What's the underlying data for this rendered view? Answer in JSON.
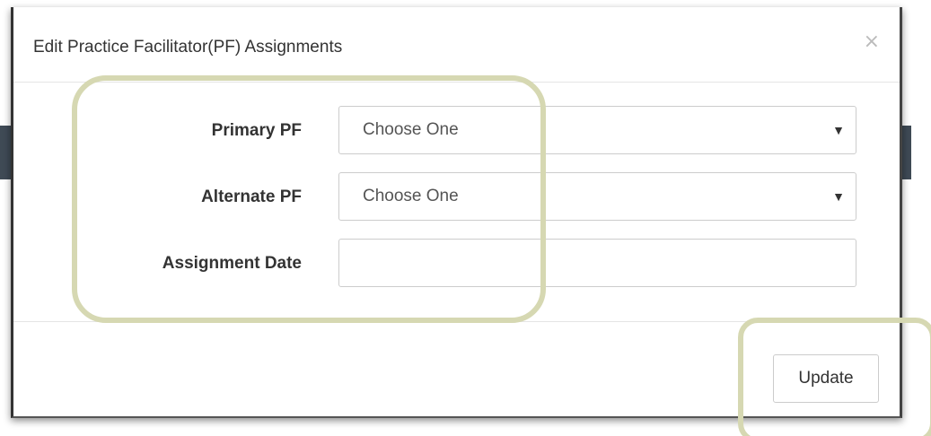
{
  "modal": {
    "title": "Edit Practice Facilitator(PF) Assignments",
    "close_label": "×"
  },
  "form": {
    "primary_pf": {
      "label": "Primary PF",
      "selected": "Choose One"
    },
    "alternate_pf": {
      "label": "Alternate PF",
      "selected": "Choose One"
    },
    "assignment_date": {
      "label": "Assignment Date",
      "value": ""
    }
  },
  "footer": {
    "update_label": "Update"
  },
  "colors": {
    "highlight": "#d6d8b2",
    "backdrop": "#3f4a55"
  },
  "icons": {
    "close": "close-icon",
    "dropdown": "chevron-down-icon"
  }
}
